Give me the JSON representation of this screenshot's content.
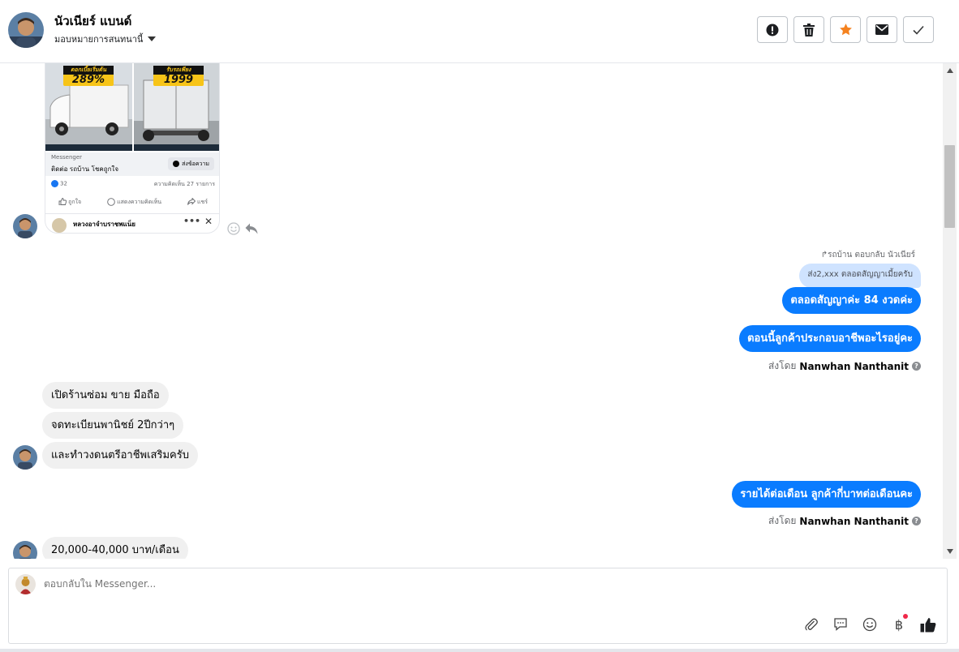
{
  "header": {
    "name": "นัวเนียร์ แบนด์",
    "assign_label": "มอบหมายการสนทนานี้",
    "actions": [
      {
        "icon": "alert-icon",
        "name": "mark-spam-button"
      },
      {
        "icon": "trash-icon",
        "name": "delete-button"
      },
      {
        "icon": "star-icon",
        "name": "star-button"
      },
      {
        "icon": "envelope-icon",
        "name": "mark-unread-button"
      },
      {
        "icon": "check-icon",
        "name": "mark-done-button"
      }
    ]
  },
  "post": {
    "promo_left_top": "ดอกเบี้ยเริ่มต้น",
    "promo_left_value": "289%",
    "promo_right_top": "รับรถเพียง",
    "promo_right_value": "1999",
    "source": "Messenger",
    "title": "ติดต่อ รถบ้าน โชคถูกใจ",
    "send_label": "ส่งข้อความ",
    "likes": "32",
    "comments": "ความคิดเห็น 27 รายการ",
    "like_label": "ถูกใจ",
    "comment_label": "แสดงความคิดเห็น",
    "share_label": "แชร์",
    "commenter": "หลวงอาจำบราชพแน็ย",
    "more": "•••",
    "close": "✕"
  },
  "messages": {
    "reply_label": "↱รถบ้าน ตอบกลับ นัวเนียร์",
    "quoted": "ส่ง2,xxx ตลอดสัญญาเมี้ยครับ",
    "out1": "ตลอดสัญญาค่ะ 84 งวดค่ะ",
    "out2": "ตอนนี้ลูกค้าประกอบอาชีพอะไรอยู่คะ",
    "sent_by_label": "ส่งโดย",
    "sent_by_name": "Nanwhan Nanthanit",
    "help": "?",
    "in1": "เปิดร้านซ่อม ขาย มือถือ",
    "in2": "จดทะเบียนพานิชย์ 2ปีกว่าๆ",
    "in3": "และทำวงดนตรีอาชีพเสริมครับ",
    "out3": "รายได้ต่อเดือน ลูกค้ากี่บาทต่อเดือนคะ",
    "in4": "20,000-40,000 บาท/เดือน"
  },
  "composer": {
    "placeholder": "ตอบกลับใน Messenger...",
    "tools": [
      "paperclip-icon",
      "saved-reply-icon",
      "emoji-icon",
      "baht-icon",
      "thumbs-up-icon"
    ],
    "baht_symbol": "฿"
  },
  "colors": {
    "brand_blue": "#0a7cff",
    "star_orange": "#f5821f",
    "incoming_bubble": "#f0f0f0",
    "quoted_bubble": "#cfe3ff"
  }
}
